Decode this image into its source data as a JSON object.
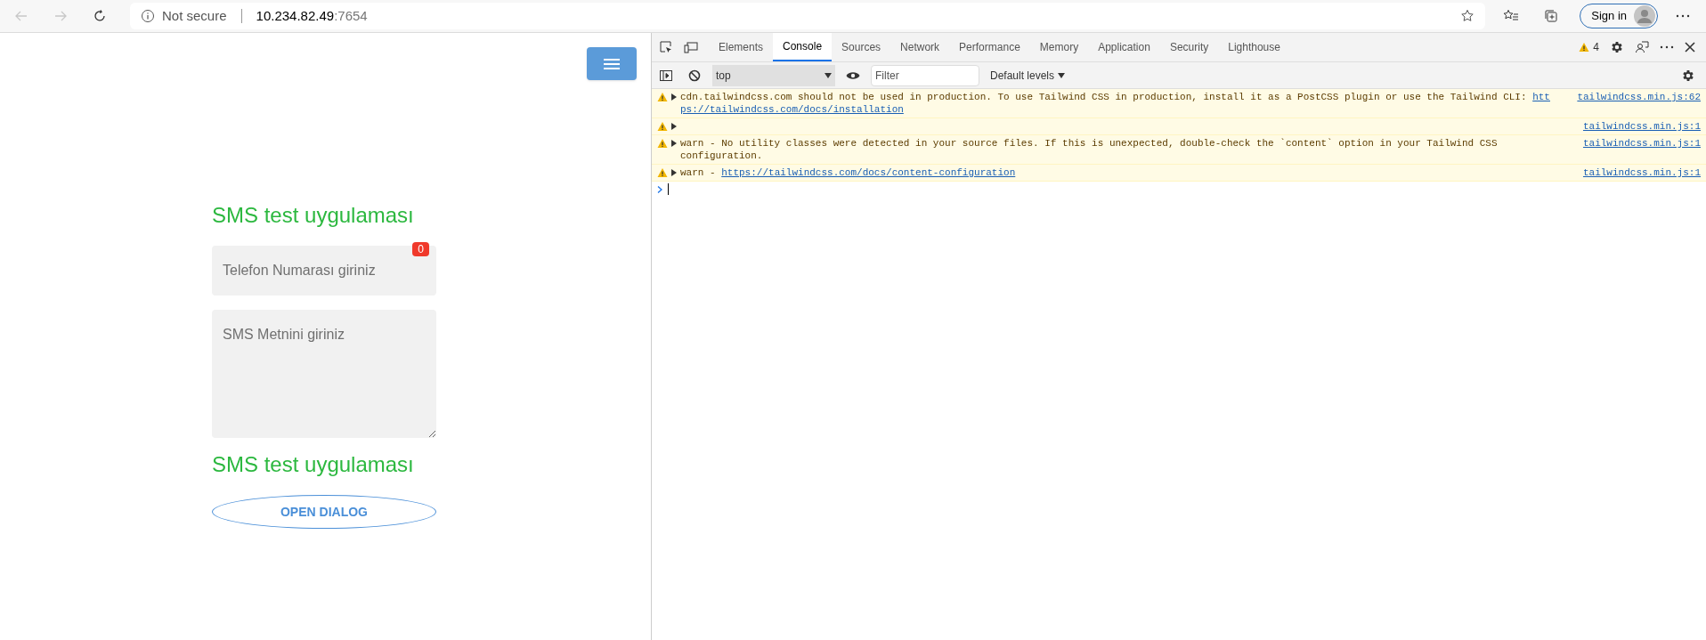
{
  "browser": {
    "nav": [
      {
        "kind": "back",
        "disabled": true
      },
      {
        "kind": "forward",
        "disabled": true
      },
      {
        "kind": "reload",
        "disabled": false
      }
    ],
    "address": {
      "security": "Not secure",
      "host": "10.234.82.49",
      "port": ":7654"
    },
    "sign_in": "Sign in"
  },
  "page": {
    "title": "SMS test uygulaması",
    "phone_field": {
      "placeholder": "Telefon Numarası giriniz",
      "badge": "0"
    },
    "message_field": {
      "placeholder": "SMS Metnini giriniz"
    },
    "footer_title": "SMS test uygulaması",
    "dialog_button": "OPEN DIALOG"
  },
  "devtools": {
    "tabs": [
      {
        "label": "Elements",
        "selected": false
      },
      {
        "label": "Console",
        "selected": true
      },
      {
        "label": "Sources",
        "selected": false
      },
      {
        "label": "Network",
        "selected": false
      },
      {
        "label": "Performance",
        "selected": false
      },
      {
        "label": "Memory",
        "selected": false
      },
      {
        "label": "Application",
        "selected": false
      },
      {
        "label": "Security",
        "selected": false
      },
      {
        "label": "Lighthouse",
        "selected": false
      }
    ],
    "warning_count": "4",
    "context": "top",
    "filter": {
      "placeholder": "Filter"
    },
    "levels": "Default levels",
    "messages": [
      {
        "text": "cdn.tailwindcss.com should not be used in production. To use Tailwind CSS in production, install it as a PostCSS plugin or use the Tailwind CLI:",
        "link_parts": [
          "htt",
          "ps://tailwindcss.com/docs/installation"
        ],
        "source": "tailwindcss.min.js:62"
      },
      {
        "source": "tailwindcss.min.js:1"
      },
      {
        "text": "warn - No utility classes were detected in your source files. If this is unexpected, double-check the `content` option in your Tailwind CSS configuration.",
        "source": "tailwindcss.min.js:1"
      },
      {
        "text": "warn -",
        "link": "https://tailwindcss.com/docs/content-configuration",
        "source": "tailwindcss.min.js:1"
      }
    ]
  }
}
